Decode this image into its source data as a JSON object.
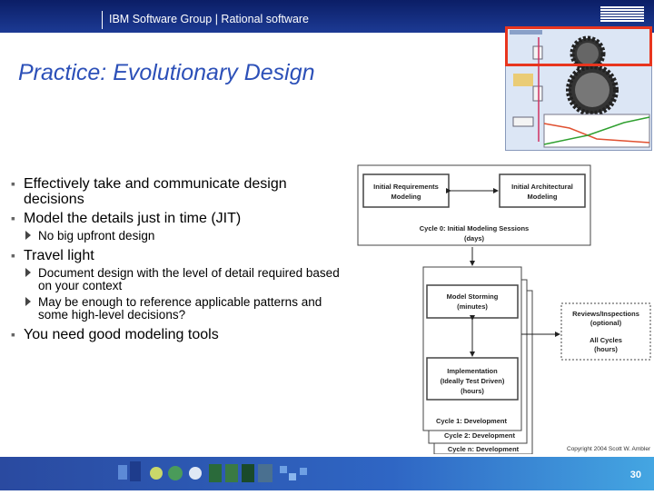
{
  "header": {
    "text": "IBM Software Group | Rational software",
    "logo": "IBM"
  },
  "slide": {
    "title": "Practice: Evolutionary Design"
  },
  "bullets": {
    "b1": "Effectively take and communicate design decisions",
    "b2": "Model the details just in time (JIT)",
    "b2_sub1": "No big upfront design",
    "b3": "Travel light",
    "b3_sub1": "Document design with the level of detail required based on your context",
    "b3_sub2": "May be enough to reference applicable patterns and some high-level decisions?",
    "b4": "You need good modeling tools"
  },
  "diagram": {
    "box1_l1": "Initial Requirements",
    "box1_l2": "Modeling",
    "box2_l1": "Initial Architectural",
    "box2_l2": "Modeling",
    "cycle0_l1": "Cycle 0: Initial Modeling Sessions",
    "cycle0_l2": "(days)",
    "storm_l1": "Model Storming",
    "storm_l2": "(minutes)",
    "impl_l1": "Implementation",
    "impl_l2": "(Ideally Test Driven)",
    "impl_l3": "(hours)",
    "cycle1": "Cycle 1: Development",
    "cycle2": "Cycle 2: Development",
    "cyclen": "Cycle n: Development",
    "review_l1": "Reviews/Inspections",
    "review_l2": "(optional)",
    "allc_l1": "All Cycles",
    "allc_l2": "(hours)"
  },
  "footer": {
    "copyright": "Copyright 2004 Scott W. Ambler",
    "page_number": "30"
  },
  "colors": {
    "header_bg": "#0b1e66",
    "title": "#2c50b8",
    "highlight": "#e8351e",
    "footer_bg": "#2f66c4"
  }
}
